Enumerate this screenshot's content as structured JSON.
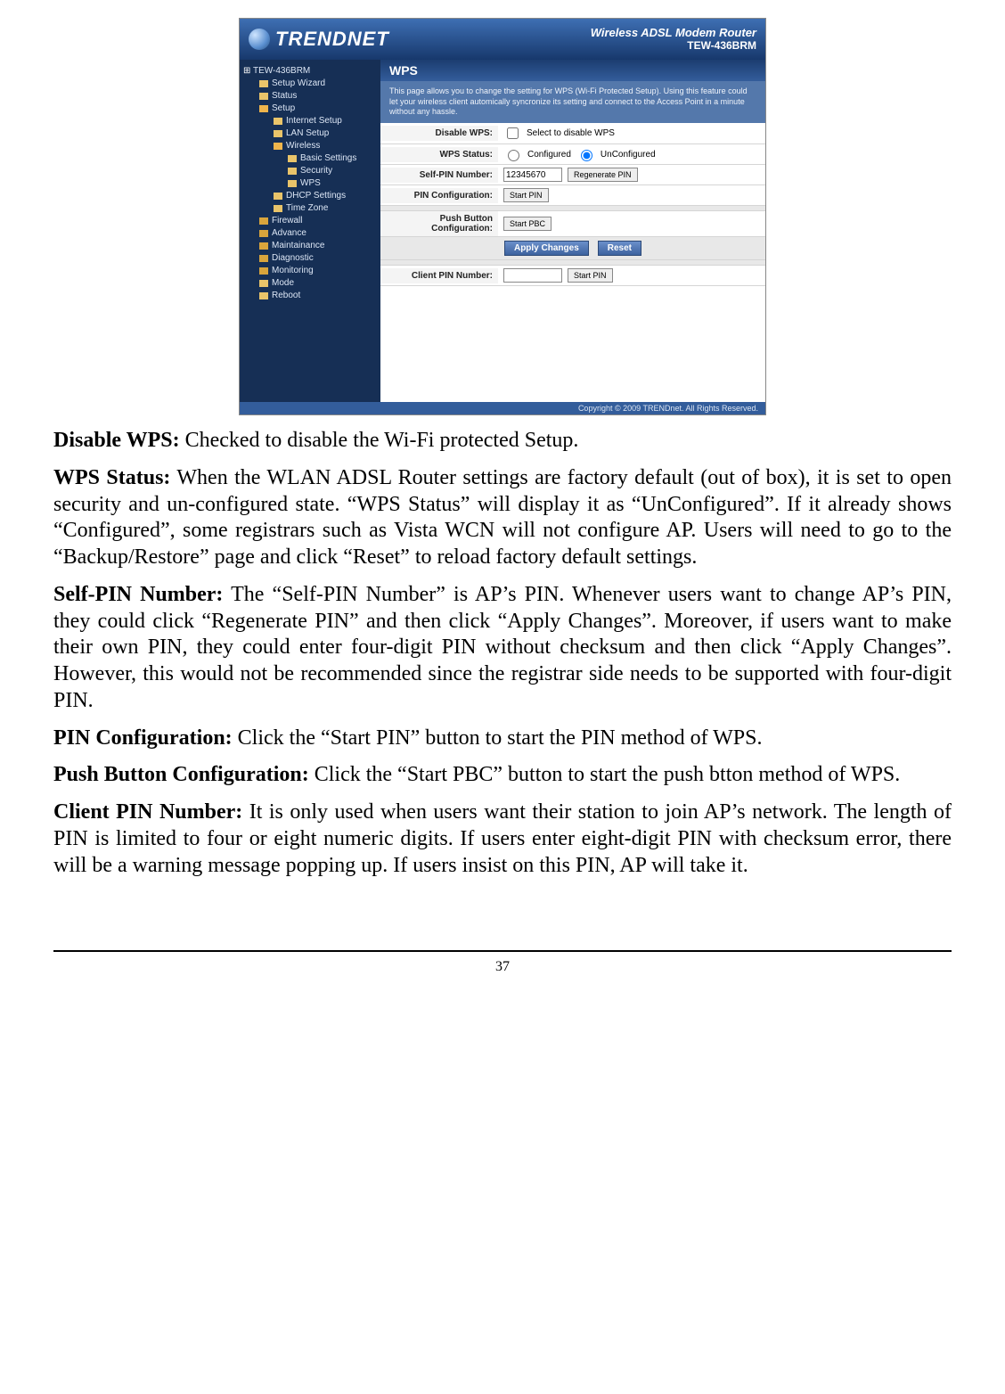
{
  "page_number": "37",
  "router": {
    "brand": "TRENDNET",
    "product_line1": "Wireless ADSL Modem Router",
    "product_line2": "TEW-436BRM",
    "footer": "Copyright © 2009 TRENDnet. All Rights Reserved.",
    "sidebar": {
      "root": "TEW-436BRM",
      "items": [
        {
          "label": "Setup Wizard",
          "icon": "page",
          "indent": 1
        },
        {
          "label": "Status",
          "icon": "page",
          "indent": 1
        },
        {
          "label": "Setup",
          "icon": "folder-open",
          "indent": 1
        },
        {
          "label": "Internet Setup",
          "icon": "page",
          "indent": 2
        },
        {
          "label": "LAN Setup",
          "icon": "page",
          "indent": 2
        },
        {
          "label": "Wireless",
          "icon": "folder-open",
          "indent": 2
        },
        {
          "label": "Basic Settings",
          "icon": "page",
          "indent": 3
        },
        {
          "label": "Security",
          "icon": "page",
          "indent": 3
        },
        {
          "label": "WPS",
          "icon": "page",
          "indent": 3
        },
        {
          "label": "DHCP Settings",
          "icon": "page",
          "indent": 2
        },
        {
          "label": "Time Zone",
          "icon": "page",
          "indent": 2
        },
        {
          "label": "Firewall",
          "icon": "folder",
          "indent": 1
        },
        {
          "label": "Advance",
          "icon": "folder",
          "indent": 1
        },
        {
          "label": "Maintainance",
          "icon": "folder",
          "indent": 1
        },
        {
          "label": "Diagnostic",
          "icon": "folder",
          "indent": 1
        },
        {
          "label": "Monitoring",
          "icon": "folder",
          "indent": 1
        },
        {
          "label": "Mode",
          "icon": "page",
          "indent": 1
        },
        {
          "label": "Reboot",
          "icon": "page",
          "indent": 1
        }
      ]
    },
    "pane": {
      "title": "WPS",
      "description": "This page allows you to change the setting for WPS (Wi-Fi Protected Setup). Using this feature could let your wireless client automically syncronize its setting and connect to the Access Point in a minute without any hassle.",
      "fields": {
        "disable_wps": {
          "label": "Disable WPS:",
          "checkbox_label": "Select to disable WPS"
        },
        "wps_status": {
          "label": "WPS Status:",
          "opt1": "Configured",
          "opt2": "UnConfigured"
        },
        "self_pin": {
          "label": "Self-PIN Number:",
          "value": "12345670",
          "button": "Regenerate PIN"
        },
        "pin_config": {
          "label": "PIN Configuration:",
          "button": "Start PIN"
        },
        "push_button": {
          "label": "Push Button Configuration:",
          "button": "Start PBC"
        },
        "client_pin": {
          "label": "Client PIN Number:",
          "value": "",
          "button": "Start PIN"
        }
      },
      "actions": {
        "apply": "Apply Changes",
        "reset": "Reset"
      }
    }
  },
  "doc": {
    "p1": {
      "title": "Disable WPS:",
      "body": "  Checked to disable the Wi-Fi protected Setup."
    },
    "p2": {
      "title": "WPS Status:",
      "body": "  When the WLAN ADSL Router settings are factory default (out of box), it is set to open security and un-configured state. “WPS Status” will display it as “UnConfigured”. If it already shows “Configured”, some registrars such as Vista WCN will not configure AP. Users will need to go to the “Backup/Restore” page and click “Reset” to reload factory default settings."
    },
    "p3": {
      "title": "Self-PIN Number:",
      "body": "  The “Self-PIN Number” is AP’s PIN. Whenever users want to change AP’s PIN, they could click “Regenerate PIN” and then click “Apply Changes”. Moreover, if users want to make their own PIN, they could enter four-digit PIN without checksum and then click “Apply Changes”. However, this would not be recommended since the registrar side needs to be supported with four-digit PIN."
    },
    "p4": {
      "title": "PIN Configuration:",
      "body": "  Click the “Start PIN” button to start the PIN method of WPS."
    },
    "p5": {
      "title": "Push Button Configuration:",
      "body": "  Click the “Start PBC” button to start the push btton method of WPS."
    },
    "p6": {
      "title": "Client PIN Number:",
      "body": "  It is only used when users want their station to join AP’s network. The length of PIN is limited to four or eight numeric digits. If users enter eight-digit PIN with checksum error, there will be a warning message popping up. If users insist on this PIN, AP will take it."
    }
  }
}
